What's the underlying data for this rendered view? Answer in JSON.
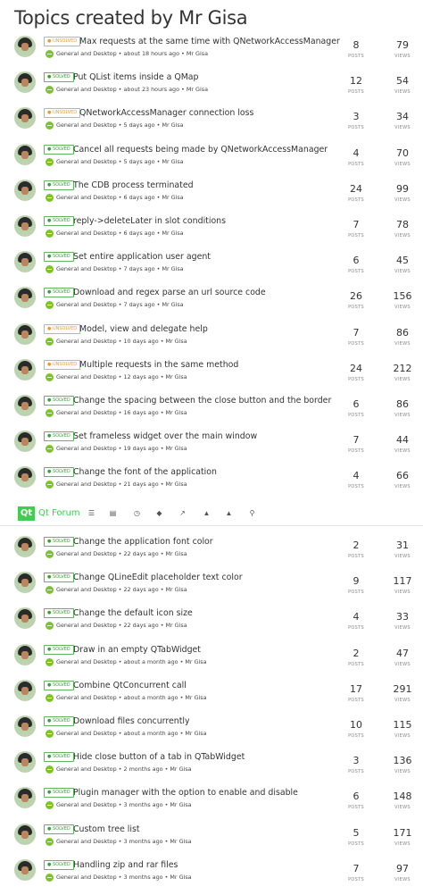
{
  "page_title": "Topics created by Mr Gisa",
  "labels": {
    "posts": "POSTS",
    "views": "VIEWS"
  },
  "colors": {
    "solved": "#5cb85c",
    "unsolved": "#f0ad4e",
    "brand": "#41cd52",
    "category": "#7dc12b"
  },
  "navbar": {
    "logo": "Qt",
    "brand": "Qt Forum",
    "icons": [
      "recent-icon",
      "categories-icon",
      "popular-icon",
      "tags-icon",
      "pin-icon",
      "user-icon",
      "groups-icon",
      "search-icon"
    ]
  },
  "topics_first": [
    {
      "status": "UNSOLVED",
      "title": "Max requests at the same time with QNetworkAccessManager",
      "category": "General and Desktop",
      "time": "about 18 hours ago",
      "author": "Mr Gisa",
      "posts": "8",
      "views": "79"
    },
    {
      "status": "SOLVED",
      "title": "Put QList items inside a QMap",
      "category": "General and Desktop",
      "time": "about 23 hours ago",
      "author": "Mr Gisa",
      "posts": "12",
      "views": "54"
    },
    {
      "status": "UNSOLVED",
      "title": "QNetworkAccessManager connection loss",
      "category": "General and Desktop",
      "time": "5 days ago",
      "author": "Mr Gisa",
      "posts": "3",
      "views": "34"
    },
    {
      "status": "SOLVED",
      "title": "Cancel all requests being made by QNetworkAccessManager",
      "category": "General and Desktop",
      "time": "5 days ago",
      "author": "Mr Gisa",
      "posts": "4",
      "views": "70"
    },
    {
      "status": "SOLVED",
      "title": "The CDB process terminated",
      "category": "General and Desktop",
      "time": "6 days ago",
      "author": "Mr Gisa",
      "posts": "24",
      "views": "99"
    },
    {
      "status": "SOLVED",
      "title": "reply->deleteLater in slot conditions",
      "category": "General and Desktop",
      "time": "6 days ago",
      "author": "Mr Gisa",
      "posts": "7",
      "views": "78"
    },
    {
      "status": "SOLVED",
      "title": "Set entire application user agent",
      "category": "General and Desktop",
      "time": "7 days ago",
      "author": "Mr Gisa",
      "posts": "6",
      "views": "45"
    },
    {
      "status": "SOLVED",
      "title": "Download and regex parse an url source code",
      "category": "General and Desktop",
      "time": "7 days ago",
      "author": "Mr Gisa",
      "posts": "26",
      "views": "156"
    },
    {
      "status": "UNSOLVED",
      "title": "Model, view and delegate help",
      "category": "General and Desktop",
      "time": "10 days ago",
      "author": "Mr Gisa",
      "posts": "7",
      "views": "86"
    },
    {
      "status": "UNSOLVED",
      "title": "Multiple requests in the same method",
      "category": "General and Desktop",
      "time": "12 days ago",
      "author": "Mr Gisa",
      "posts": "24",
      "views": "212"
    },
    {
      "status": "SOLVED",
      "title": "Change the spacing between the close button and the border",
      "category": "General and Desktop",
      "time": "16 days ago",
      "author": "Mr Gisa",
      "posts": "6",
      "views": "86"
    },
    {
      "status": "SOLVED",
      "title": "Set frameless widget over the main window",
      "category": "General and Desktop",
      "time": "19 days ago",
      "author": "Mr Gisa",
      "posts": "7",
      "views": "44"
    },
    {
      "status": "SOLVED",
      "title": "Change the font of the application",
      "category": "General and Desktop",
      "time": "21 days ago",
      "author": "Mr Gisa",
      "posts": "4",
      "views": "66"
    }
  ],
  "topics_second": [
    {
      "status": "SOLVED",
      "title": "Change the application font color",
      "category": "General and Desktop",
      "time": "22 days ago",
      "author": "Mr Gisa",
      "posts": "2",
      "views": "31"
    },
    {
      "status": "SOLVED",
      "title": "Change QLineEdit placeholder text color",
      "category": "General and Desktop",
      "time": "22 days ago",
      "author": "Mr Gisa",
      "posts": "9",
      "views": "117"
    },
    {
      "status": "SOLVED",
      "title": "Change the default icon size",
      "category": "General and Desktop",
      "time": "22 days ago",
      "author": "Mr Gisa",
      "posts": "4",
      "views": "33"
    },
    {
      "status": "SOLVED",
      "title": "Draw in an empty QTabWidget",
      "category": "General and Desktop",
      "time": "about a month ago",
      "author": "Mr Gisa",
      "posts": "2",
      "views": "47"
    },
    {
      "status": "SOLVED",
      "title": "Combine QtConcurrent call",
      "category": "General and Desktop",
      "time": "about a month ago",
      "author": "Mr Gisa",
      "posts": "17",
      "views": "291"
    },
    {
      "status": "SOLVED",
      "title": "Download files concurrently",
      "category": "General and Desktop",
      "time": "about a month ago",
      "author": "Mr Gisa",
      "posts": "10",
      "views": "115"
    },
    {
      "status": "SOLVED",
      "title": "Hide close button of a tab in QTabWidget",
      "category": "General and Desktop",
      "time": "2 months ago",
      "author": "Mr Gisa",
      "posts": "3",
      "views": "136"
    },
    {
      "status": "SOLVED",
      "title": "Plugin manager with the option to enable and disable",
      "category": "General and Desktop",
      "time": "3 months ago",
      "author": "Mr Gisa",
      "posts": "6",
      "views": "148"
    },
    {
      "status": "SOLVED",
      "title": "Custom tree list",
      "category": "General and Desktop",
      "time": "3 months ago",
      "author": "Mr Gisa",
      "posts": "5",
      "views": "171"
    },
    {
      "status": "SOLVED",
      "title": "Handling zip and rar files",
      "category": "General and Desktop",
      "time": "3 months ago",
      "author": "Mr Gisa",
      "posts": "7",
      "views": "97"
    }
  ]
}
